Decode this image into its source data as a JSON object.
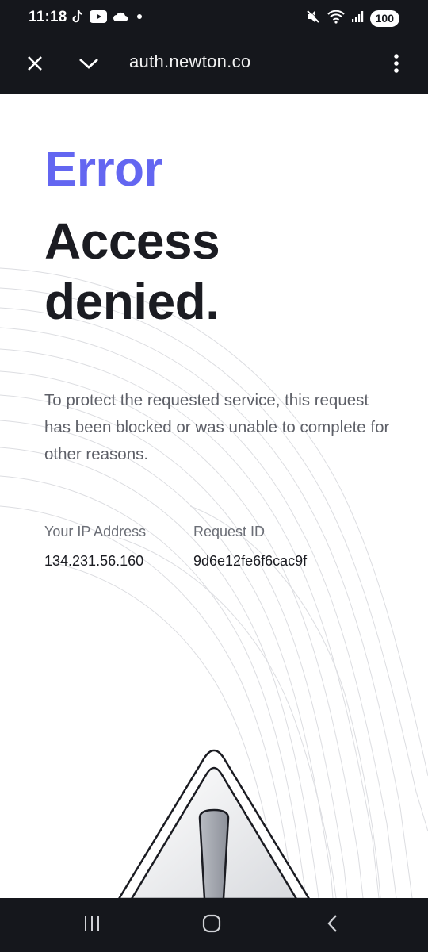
{
  "status_bar": {
    "time": "11:18",
    "left_icons": [
      "tiktok-icon",
      "youtube-icon",
      "cloud-icon",
      "dot-icon"
    ],
    "right_icons": [
      "mute-icon",
      "wifi-icon",
      "signal-icon"
    ],
    "battery": "100"
  },
  "browser": {
    "url": "auth.newton.co",
    "buttons": [
      "close-icon",
      "chevron-down-icon",
      "more-vert-icon"
    ]
  },
  "page": {
    "error_label": "Error",
    "headline_line1": "Access",
    "headline_line2": "denied.",
    "description": "To protect the requested service, this request has been blocked or was unable to complete for other reasons.",
    "ip_label": "Your IP Address",
    "ip_value": "134.231.56.160",
    "request_label": "Request ID",
    "request_value": "9d6e12fe6f6cac9f"
  },
  "colors": {
    "accent": "#6366f1",
    "heading": "#1b1c22",
    "body_text": "#5e6068",
    "system_bar": "#15171c"
  },
  "nav_bar": {
    "buttons": [
      "recents-icon",
      "home-icon",
      "back-icon"
    ]
  }
}
